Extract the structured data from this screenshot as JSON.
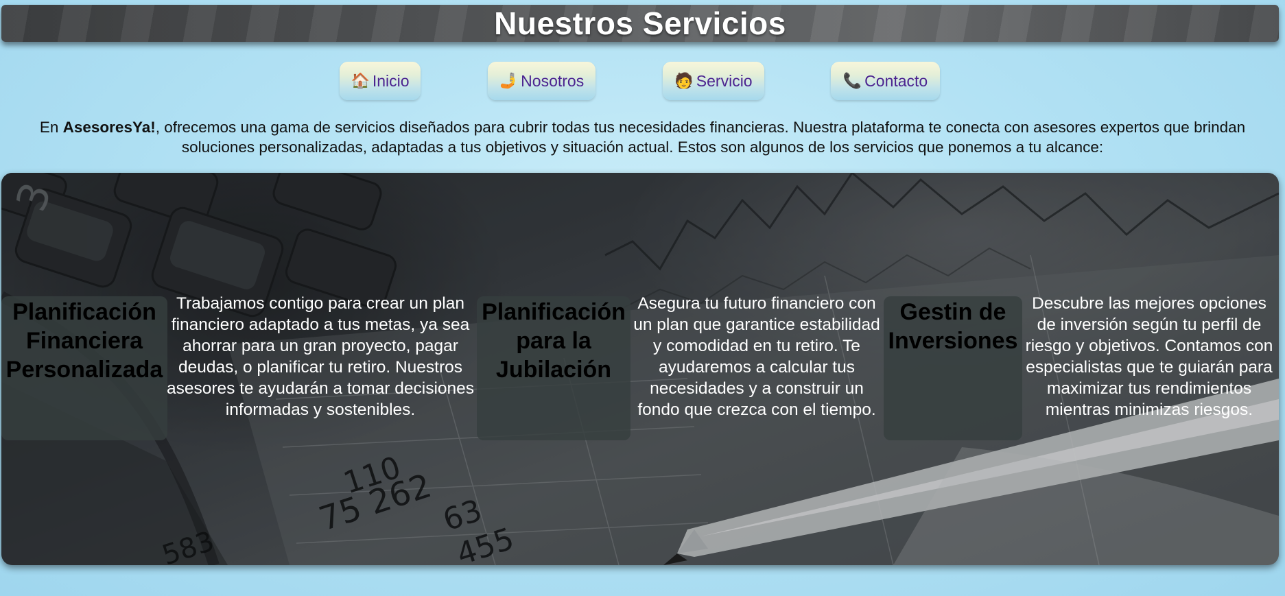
{
  "header": {
    "title": "Nuestros Servicios"
  },
  "nav": {
    "items": [
      {
        "icon": "🏠",
        "icon_name": "house-icon",
        "label": "Inicio"
      },
      {
        "icon": "🤳",
        "icon_name": "selfie-hand-icon",
        "label": "Nosotros"
      },
      {
        "icon": "🧑",
        "icon_name": "person-icon",
        "label": "Servicio"
      },
      {
        "icon": "📞",
        "icon_name": "phone-icon",
        "label": "Contacto"
      }
    ],
    "text_color": "#4b2390"
  },
  "intro": {
    "prefix": "En ",
    "brand": "AsesoresYa!",
    "text": ", ofrecemos una gama de servicios diseñados para cubrir todas tus necesidades financieras. Nuestra plataforma te conecta con asesores expertos que brindan soluciones personalizadas, adaptadas a tus objetivos y situación actual. Estos son algunos de los servicios que ponemos a tu alcance:"
  },
  "services": [
    {
      "title": "Planificación Financiera Personalizada",
      "description": "Trabajamos contigo para crear un plan financiero adaptado a tus metas, ya sea ahorrar para un gran proyecto, pagar deudas, o planificar tu retiro. Nuestros asesores te ayudarán a tomar decisiones informadas y sostenibles."
    },
    {
      "title": "Planificación para la Jubilación",
      "description": "Asegura tu futuro financiero con un plan que garantice estabilidad y comodidad en tu retiro. Te ayudaremos a calcular tus necesidades y a construir un fondo que crezca con el tiempo."
    },
    {
      "title": "Gestin de Inversiones",
      "description": "Descubre las mejores opciones de inversión según tu perfil de riesgo y objetivos. Contamos con especialistas que te guiarán para maximizar tus rendimientos mientras minimizas riesgos."
    }
  ],
  "background_image": {
    "numbers": [
      "110",
      "75 262",
      "63",
      "455",
      "583"
    ],
    "calculator_key": "3"
  }
}
